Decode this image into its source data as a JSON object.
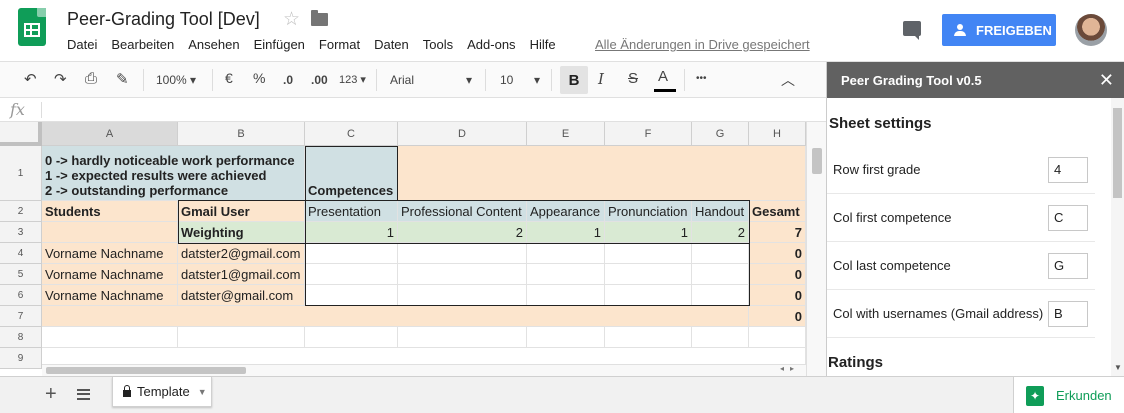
{
  "app": {
    "title": "Peer-Grading Tool [Dev]",
    "menu": [
      "Datei",
      "Bearbeiten",
      "Ansehen",
      "Einfügen",
      "Format",
      "Daten",
      "Tools",
      "Add-ons",
      "Hilfe"
    ],
    "saved_status": "Alle Änderungen in Drive gespeichert",
    "share_label": "FREIGEBEN",
    "accent_color": "#4285f4",
    "brand_color": "#0f9d58"
  },
  "toolbar": {
    "zoom": "100%",
    "currency": "€",
    "percent": "%",
    "dec_less": ".0",
    "dec_more": ".00",
    "format_more": "123",
    "font": "Arial",
    "font_size": "10",
    "bold": "B",
    "italic": "I",
    "strike": "S",
    "text_color": "A",
    "more": "•••"
  },
  "formula_bar": {
    "fx": "fx",
    "content": ""
  },
  "grid": {
    "columns": [
      "A",
      "B",
      "C",
      "D",
      "E",
      "F",
      "G",
      "H"
    ],
    "rows": [
      "1",
      "2",
      "3",
      "4",
      "5",
      "6",
      "7",
      "8",
      "9"
    ],
    "legend": [
      "0 -> hardly noticeable work performance",
      "1 -> expected results were achieved",
      "2 -> outstanding performance"
    ],
    "competences_label": "Competences",
    "header_students": "Students",
    "header_gmail": "Gmail User",
    "competences": [
      "Presentation",
      "Professional Content",
      "Appearance",
      "Pronunciation",
      "Handout"
    ],
    "header_total": "Gesamt",
    "weighting_label": "Weighting",
    "weights": [
      "1",
      "2",
      "1",
      "1",
      "2"
    ],
    "weight_total": "7",
    "students": [
      {
        "name": "Vorname Nachname",
        "email": "datster2@gmail.com",
        "total": "0"
      },
      {
        "name": "Vorname Nachname",
        "email": "datster1@gmail.com",
        "total": "0"
      },
      {
        "name": "Vorname Nachname",
        "email": "datster@gmail.com",
        "total": "0"
      }
    ],
    "row7_total": "0"
  },
  "sheet_tabs": {
    "active": "Template",
    "explore_label": "Erkunden"
  },
  "sidebar": {
    "title": "Peer Grading Tool v0.5",
    "section_sheet": "Sheet settings",
    "settings": [
      {
        "label": "Row first grade",
        "value": "4"
      },
      {
        "label": "Col first competence",
        "value": "C"
      },
      {
        "label": "Col last competence",
        "value": "G"
      },
      {
        "label": "Col with usernames (Gmail address)",
        "value": "B"
      }
    ],
    "section_ratings": "Ratings"
  }
}
